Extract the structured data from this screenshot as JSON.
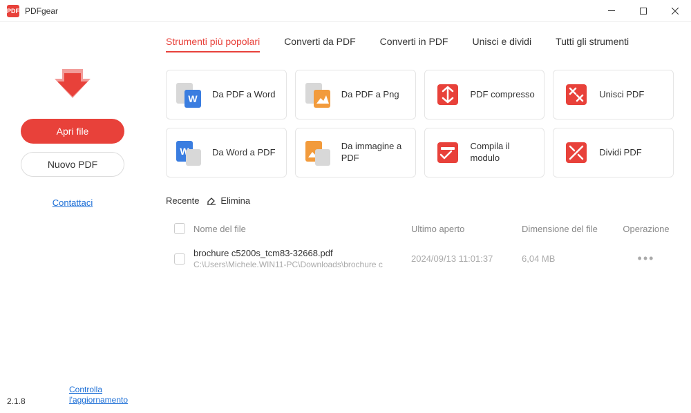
{
  "titlebar": {
    "app_name": "PDFgear",
    "logo_text": "PDF"
  },
  "sidebar": {
    "open_file": "Apri file",
    "new_pdf": "Nuovo PDF",
    "contact": "Contattaci",
    "version": "2.1.8",
    "update": "Controlla l'aggiornamento"
  },
  "tabs": [
    {
      "label": "Strumenti più popolari",
      "active": true
    },
    {
      "label": "Converti da PDF",
      "active": false
    },
    {
      "label": "Converti in PDF",
      "active": false
    },
    {
      "label": "Unisci e dividi",
      "active": false
    },
    {
      "label": "Tutti gli strumenti",
      "active": false
    }
  ],
  "tools": [
    {
      "id": "pdf-to-word",
      "label": "Da PDF a Word"
    },
    {
      "id": "pdf-to-png",
      "label": "Da PDF a Png"
    },
    {
      "id": "compress",
      "label": "PDF compresso"
    },
    {
      "id": "merge",
      "label": "Unisci PDF"
    },
    {
      "id": "word-to-pdf",
      "label": "Da Word a PDF"
    },
    {
      "id": "img-to-pdf",
      "label": "Da immagine a PDF"
    },
    {
      "id": "fill-form",
      "label": "Compila il modulo"
    },
    {
      "id": "split",
      "label": "Dividi PDF"
    }
  ],
  "recent": {
    "label": "Recente",
    "delete": "Elimina"
  },
  "table": {
    "headers": {
      "name": "Nome del file",
      "date": "Ultimo aperto",
      "size": "Dimensione del file",
      "op": "Operazione"
    },
    "rows": [
      {
        "name": "brochure c5200s_tcm83-32668.pdf",
        "path": "C:\\Users\\Michele.WIN11-PC\\Downloads\\brochure c",
        "date": "2024/09/13 11:01:37",
        "size": "6,04 MB"
      }
    ]
  }
}
